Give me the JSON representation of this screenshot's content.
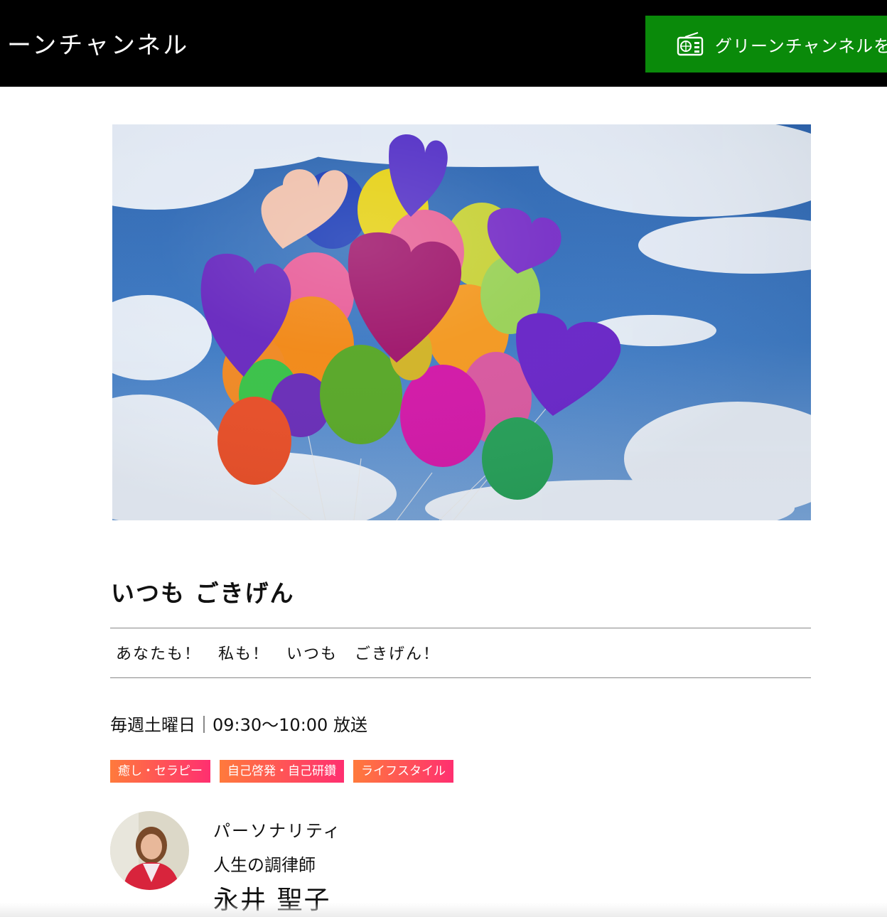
{
  "header": {
    "site_title": "ーンチャンネル",
    "listen_button_label": "グリーンチャンネルを"
  },
  "colors": {
    "header_bg": "#000000",
    "listen_button_bg": "#0a8a0a",
    "tag_gradient_start": "#ff7a3c",
    "tag_gradient_end": "#ff2f70"
  },
  "program": {
    "title": "いつも ごきげん",
    "tagline": "あなたも！　私も！　いつも　ごきげん！",
    "schedule": "毎週土曜日｜09:30〜10:00 放送",
    "tags": [
      "癒し・セラピー",
      "自己啓発・自己研鑽",
      "ライフスタイル"
    ]
  },
  "personality": {
    "label": "パーソナリティ",
    "role": "人生の調律師",
    "name": "永井 聖子"
  },
  "icons": {
    "listen_button": "radio-icon"
  }
}
